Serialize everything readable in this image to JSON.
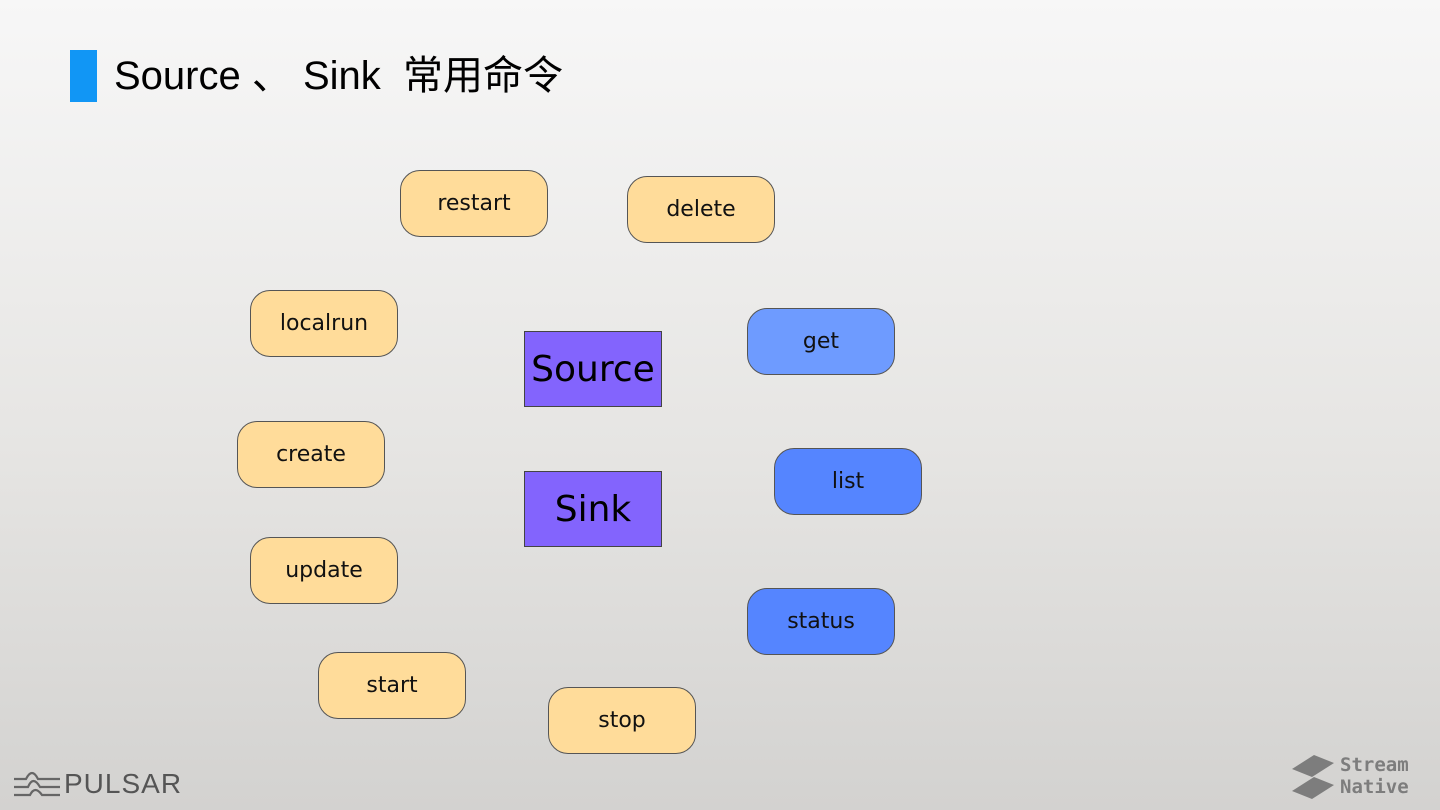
{
  "title": "Source 、 Sink  常用命令",
  "core": {
    "source": "Source",
    "sink": "Sink"
  },
  "commands": {
    "restart": "restart",
    "delete": "delete",
    "localrun": "localrun",
    "get": "get",
    "create": "create",
    "list": "list",
    "update": "update",
    "status": "status",
    "start": "start",
    "stop": "stop"
  },
  "colors": {
    "accent": "#1196f5",
    "cmd_fill": "#ffdc9a",
    "query_fill_light": "#6e9bff",
    "query_fill": "#5585ff",
    "core_fill": "#8364fd"
  },
  "logos": {
    "pulsar": "PULSAR",
    "streamnative_line1": "Stream",
    "streamnative_line2": "Native"
  }
}
